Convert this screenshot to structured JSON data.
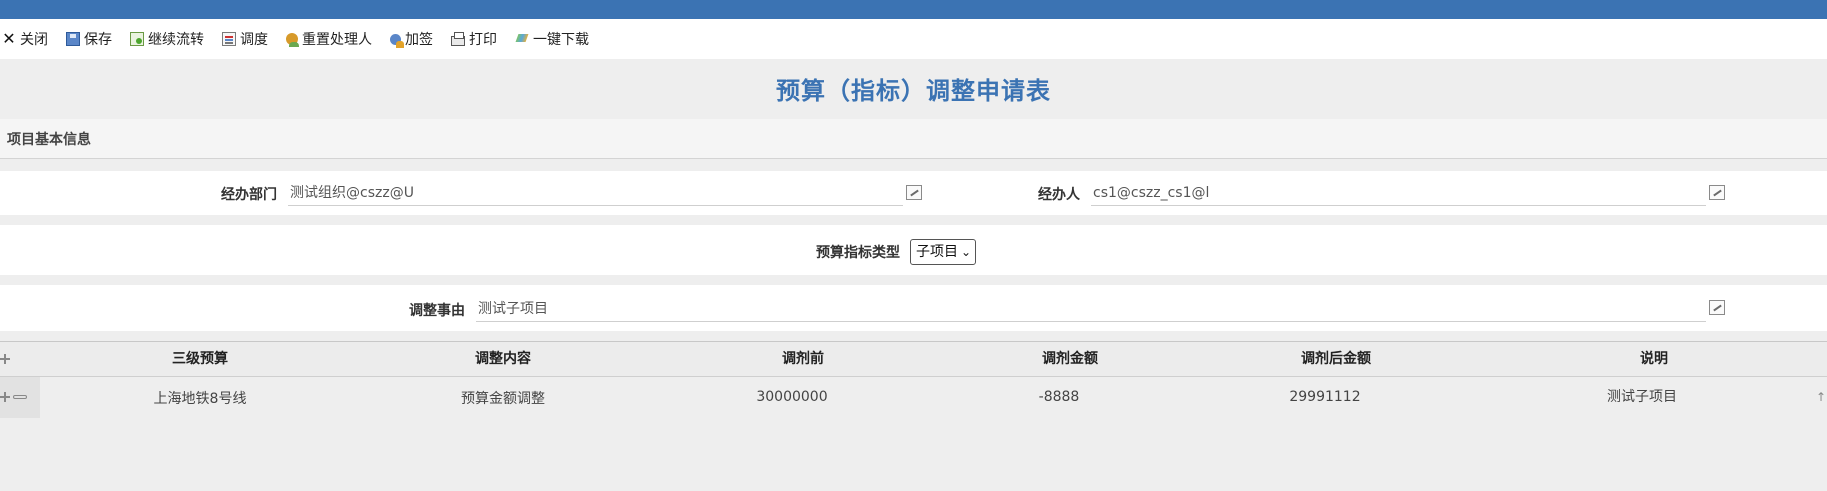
{
  "toolbar": {
    "close": "关闭",
    "save": "保存",
    "continue_flow": "继续流转",
    "dispatch": "调度",
    "reset_handler": "重置处理人",
    "add_sign": "加签",
    "print": "打印",
    "download": "一键下载"
  },
  "form": {
    "title": "预算（指标）调整申请表",
    "section": "项目基本信息",
    "dept_label": "经办部门",
    "dept_value": "测试组织@cszz@U",
    "handler_label": "经办人",
    "handler_value": "cs1@cszz_cs1@l",
    "type_label": "预算指标类型",
    "type_value": "子项目",
    "reason_label": "调整事由",
    "reason_value": "测试子项目"
  },
  "grid": {
    "columns": [
      "三级预算",
      "调整内容",
      "调剂前",
      "调剂金额",
      "调剂后金额",
      "说明"
    ],
    "rows": [
      [
        "上海地铁8号线",
        "预算金额调整",
        "30000000",
        "-8888",
        "29991112",
        "测试子项目"
      ]
    ]
  },
  "icons": {
    "close": "close-icon",
    "save": "save-icon",
    "flow": "flow-icon",
    "dispatch": "dispatch-icon",
    "reset": "user-reset-icon",
    "sign": "add-sign-icon",
    "print": "print-icon",
    "download": "download-icon",
    "edit": "edit-icon",
    "add": "add-icon",
    "remove": "remove-icon",
    "sort": "sort-up-icon"
  },
  "colors": {
    "topbar": "#3b73b3",
    "title": "#3b73b3"
  }
}
